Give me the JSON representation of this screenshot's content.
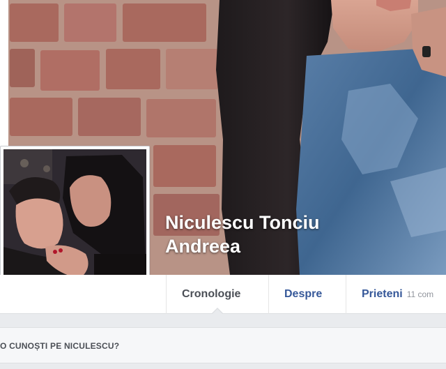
{
  "profile": {
    "name_line1": "Niculescu Tonciu",
    "name_line2": "Andreea"
  },
  "nav": {
    "timeline_label": "Cronologie",
    "about_label": "Despre",
    "friends_label": "Prieteni",
    "friends_count": "11 com"
  },
  "prompt": {
    "know_text": "O CUNOȘTI PE NICULESCU?"
  },
  "colors": {
    "link": "#365899",
    "active_tab": "#4b4f56",
    "background": "#e9ebee"
  }
}
